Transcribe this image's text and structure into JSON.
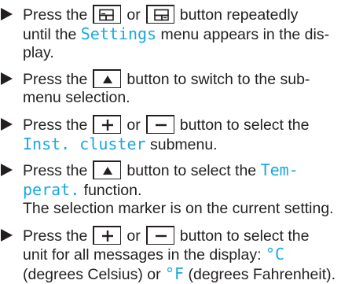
{
  "steps": [
    {
      "line1": {
        "press": "Press the",
        "or": "or",
        "rest": "button repeatedly"
      },
      "line2": {
        "pre": "until the",
        "hl": "Settings",
        "post": "menu appears in the dis-"
      },
      "line3": "play.",
      "buttons": [
        "display-left-icon",
        "display-right-icon"
      ]
    },
    {
      "line1": {
        "press": "Press the",
        "rest": "button to switch to the sub-"
      },
      "line2": "menu selection.",
      "buttons": [
        "up-arrow-icon"
      ]
    },
    {
      "line1": {
        "press": "Press the",
        "or": "or",
        "rest": "button to select the"
      },
      "line2": {
        "hl": "Inst. cluster",
        "post": "submenu."
      },
      "buttons": [
        "plus-icon",
        "minus-icon"
      ]
    },
    {
      "line1": {
        "press": "Press the",
        "rest": "button to select the",
        "hl": "Tem-"
      },
      "line2": {
        "hl": "perat.",
        "post": "function."
      },
      "note": "The selection marker is on the current setting.",
      "buttons": [
        "up-arrow-icon"
      ]
    },
    {
      "line1": {
        "press": "Press the",
        "or": "or",
        "rest": "button to select the"
      },
      "line2": {
        "pre": "unit for all messages in the display:",
        "hl": "°C"
      },
      "line3": {
        "pre": "(degrees Celsius) or",
        "hl": "°F",
        "post": "(degrees Fahrenheit)."
      },
      "buttons": [
        "plus-icon",
        "minus-icon"
      ]
    }
  ],
  "colors": {
    "text": "#231f20",
    "highlight": "#1aa7e0"
  }
}
